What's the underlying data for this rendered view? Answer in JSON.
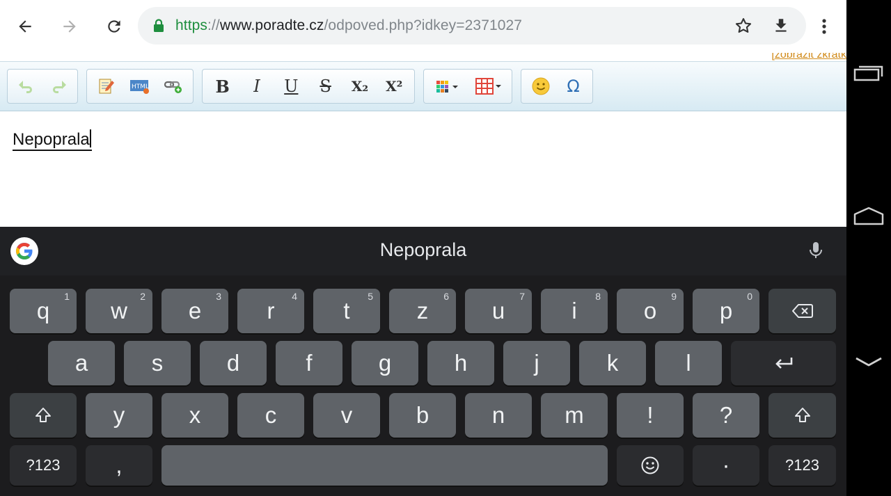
{
  "browser": {
    "url_scheme": "https",
    "url_separator": "://",
    "url_host": "www.poradte.cz",
    "url_path": "/odpoved.php?idkey=2371027",
    "icons": [
      "back-arrow-icon",
      "forward-arrow-icon",
      "reload-icon",
      "lock-icon",
      "star-icon",
      "download-icon",
      "more-vert-icon"
    ]
  },
  "page": {
    "top_link": "[zobrazit zkratk",
    "editor_text": "Nepoprala",
    "toolbar": {
      "bold": "B",
      "italic": "I",
      "underline": "U",
      "strike": "S",
      "subscript": "X₂",
      "superscript": "X²",
      "omega": "Ω"
    }
  },
  "keyboard": {
    "suggestion": "Nepoprala",
    "row1": [
      {
        "label": "q",
        "hint": "1"
      },
      {
        "label": "w",
        "hint": "2"
      },
      {
        "label": "e",
        "hint": "3"
      },
      {
        "label": "r",
        "hint": "4"
      },
      {
        "label": "t",
        "hint": "5"
      },
      {
        "label": "z",
        "hint": "6"
      },
      {
        "label": "u",
        "hint": "7"
      },
      {
        "label": "i",
        "hint": "8"
      },
      {
        "label": "o",
        "hint": "9"
      },
      {
        "label": "p",
        "hint": "0"
      }
    ],
    "row2": [
      "a",
      "s",
      "d",
      "f",
      "g",
      "h",
      "j",
      "k",
      "l"
    ],
    "row3": [
      "y",
      "x",
      "c",
      "v",
      "b",
      "n",
      "m",
      "!",
      "?"
    ],
    "symbols_label": "?123",
    "comma": ",",
    "period": "·"
  },
  "colors": {
    "url_scheme": "#1e8e3e",
    "keyboard_bg": "#202124",
    "key_bg": "#5f6368",
    "link": "#d18b1b"
  }
}
